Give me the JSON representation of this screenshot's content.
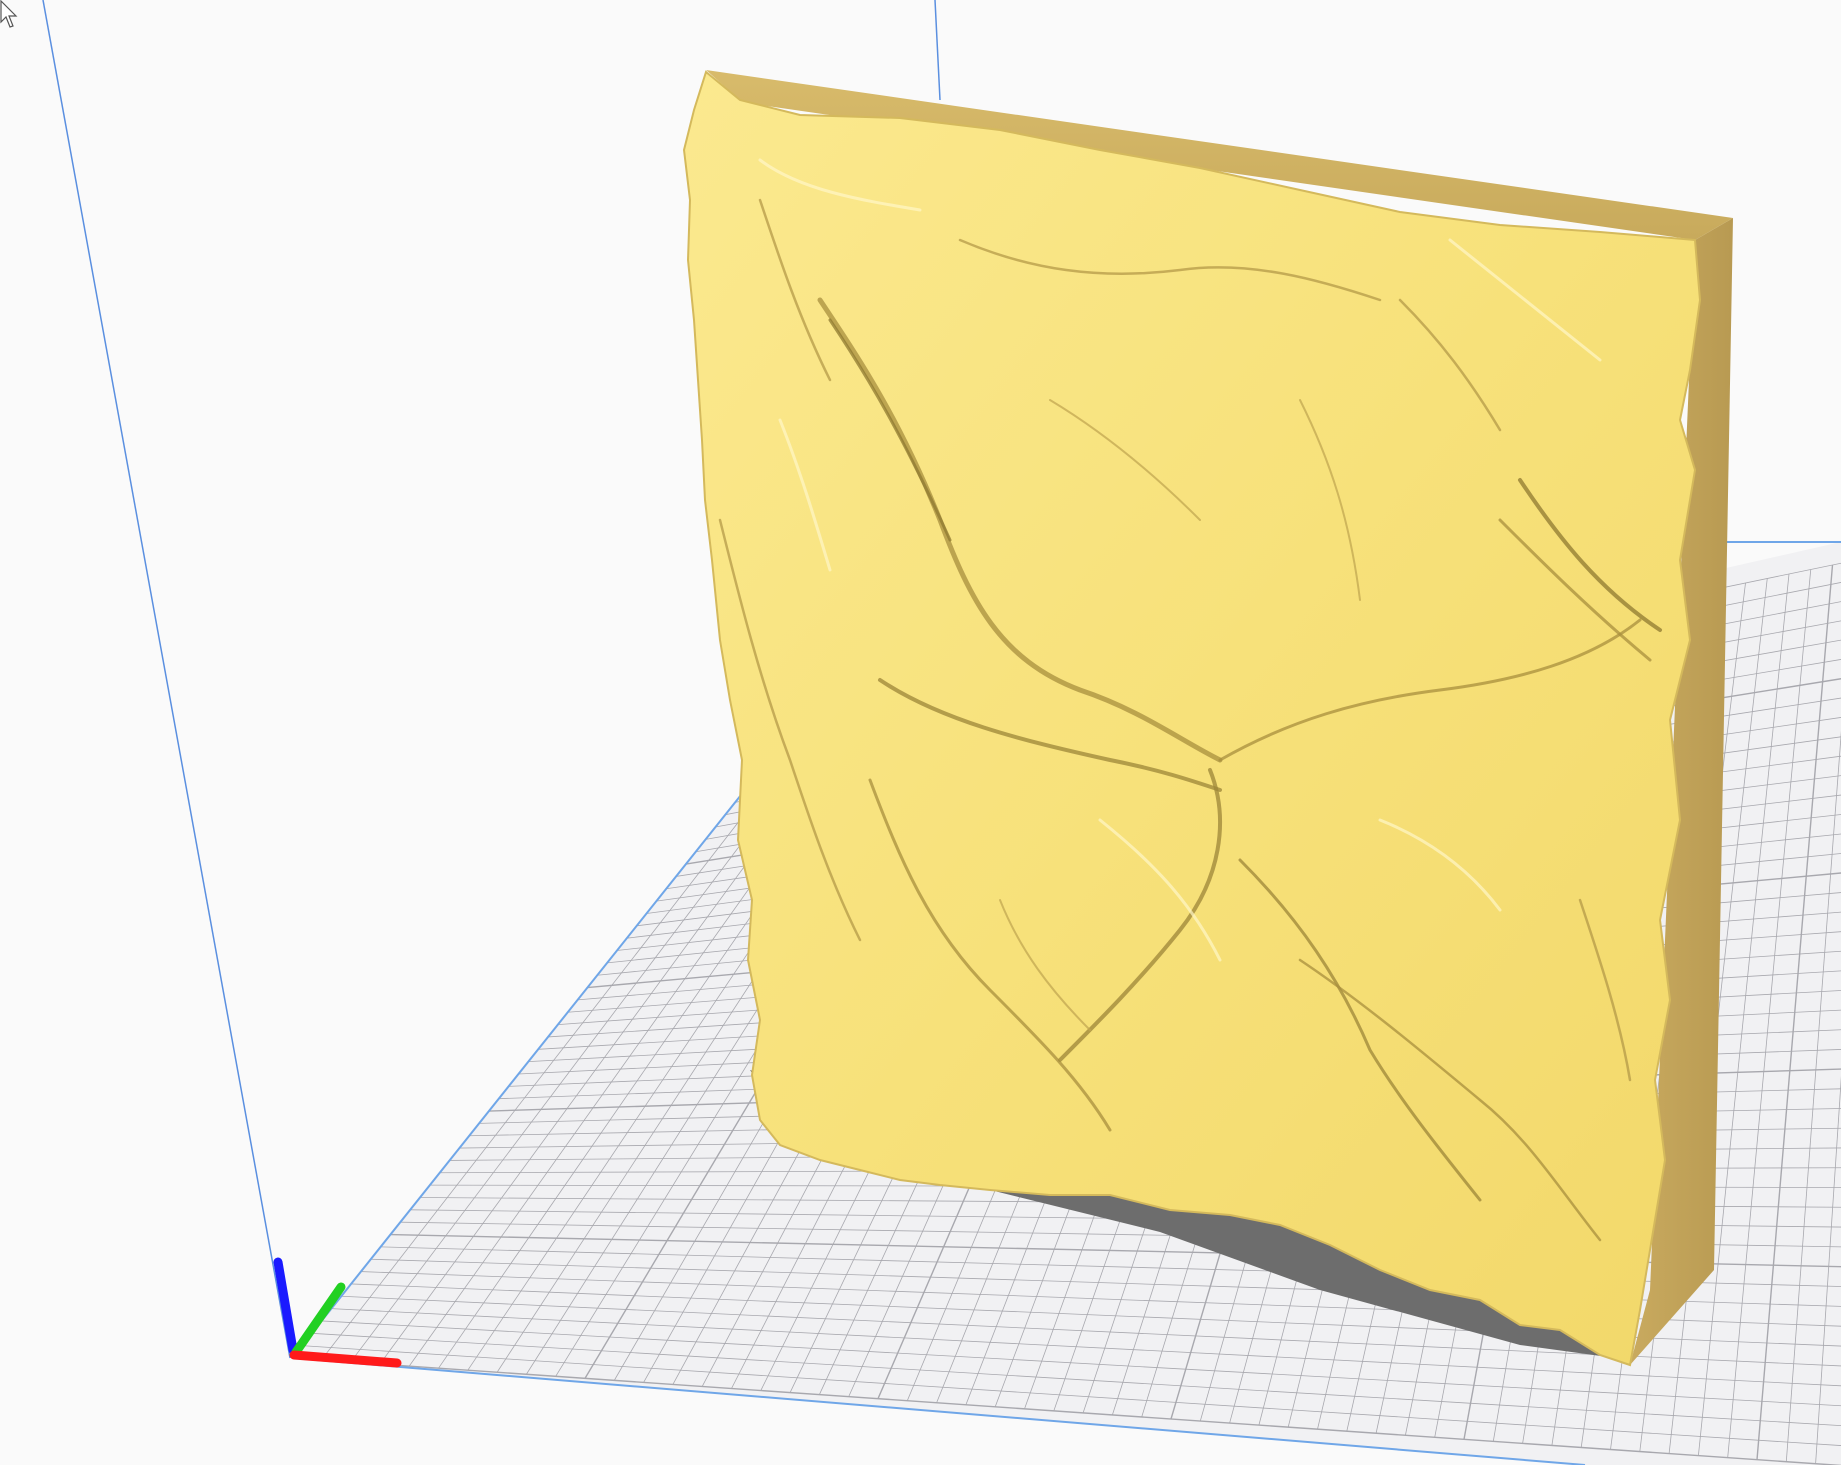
{
  "app": {
    "view": "3d-viewport",
    "model": {
      "type": "terrain-relief",
      "color": "#f7e17a",
      "side_color": "#c9aa5f",
      "shadow_color": "#6d6d6d"
    },
    "build_plate": {
      "background": "#f2f2f2",
      "grid_color": "#a8a8ae",
      "edge_color": "#6fa6e8"
    },
    "axes": {
      "x_color": "#ff1a1a",
      "y_color": "#22d022",
      "z_color": "#1a1aff"
    },
    "guide_line_color": "#5a8fe0",
    "cursor_icon": "arrow-cursor-icon"
  }
}
